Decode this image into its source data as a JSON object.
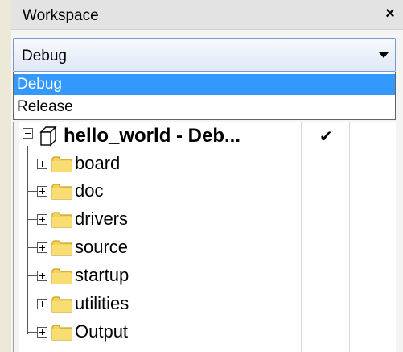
{
  "panel": {
    "title": "Workspace",
    "close_glyph": "×"
  },
  "config_select": {
    "value": "Debug",
    "options": [
      "Debug",
      "Release"
    ],
    "highlighted": "Debug"
  },
  "tree": {
    "root": {
      "label": "hello_world - Deb...",
      "check": "✔",
      "icon": "project-cube-icon"
    },
    "children": [
      {
        "label": "board",
        "icon": "folder-icon"
      },
      {
        "label": "doc",
        "icon": "folder-icon"
      },
      {
        "label": "drivers",
        "icon": "folder-icon"
      },
      {
        "label": "source",
        "icon": "folder-icon"
      },
      {
        "label": "startup",
        "icon": "folder-icon"
      },
      {
        "label": "utilities",
        "icon": "folder-icon"
      },
      {
        "label": "Output",
        "icon": "folder-icon"
      }
    ]
  },
  "colors": {
    "selection": "#3399ff",
    "folder": "#f5d35a"
  }
}
